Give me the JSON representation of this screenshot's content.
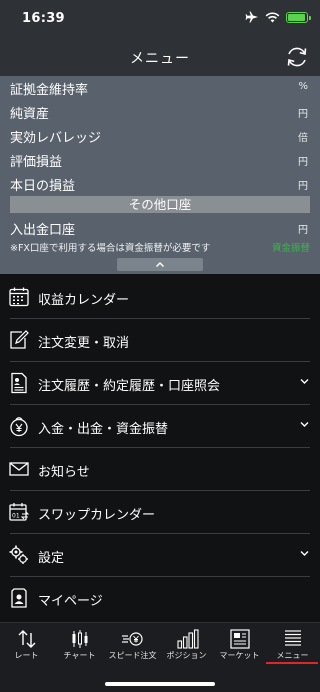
{
  "status_bar": {
    "time": "16:39",
    "battery_level": 0.85,
    "battery_color": "#5ed04f"
  },
  "header": {
    "title": "メニュー",
    "refresh_icon": "refresh-icon"
  },
  "account": {
    "rows": [
      {
        "label": "証拠金維持率",
        "unit": "%"
      },
      {
        "label": "純資産",
        "unit": "円"
      },
      {
        "label": "実効レバレッジ",
        "unit": "倍"
      },
      {
        "label": "評価損益",
        "unit": "円"
      },
      {
        "label": "本日の損益",
        "unit": "円"
      }
    ],
    "section_title": "その他口座",
    "deposit_row": {
      "label": "入出金口座",
      "unit": "円"
    },
    "note": "※FX口座で利用する場合は資金振替が必要です",
    "note_link": "資金振替",
    "collapse_icon": "chevron-up-icon"
  },
  "menu": {
    "items": [
      {
        "label": "収益カレンダー",
        "icon": "calendar-icon",
        "expandable": false
      },
      {
        "label": "注文変更・取消",
        "icon": "edit-icon",
        "expandable": false
      },
      {
        "label": "注文履歴・約定履歴・口座照会",
        "icon": "document-icon",
        "expandable": true
      },
      {
        "label": "入金・出金・資金振替",
        "icon": "yen-coin-icon",
        "expandable": true
      },
      {
        "label": "お知らせ",
        "icon": "mail-icon",
        "expandable": false
      },
      {
        "label": "スワップカレンダー",
        "icon": "swap-calendar-icon",
        "expandable": false
      },
      {
        "label": "設定",
        "icon": "gear-icon",
        "expandable": true
      },
      {
        "label": "マイページ",
        "icon": "mypage-icon",
        "expandable": false
      }
    ]
  },
  "tabbar": {
    "tabs": [
      {
        "label": "レート",
        "icon": "rate-arrows-icon"
      },
      {
        "label": "チャート",
        "icon": "candlestick-icon"
      },
      {
        "label": "スピード注文",
        "icon": "speed-order-icon"
      },
      {
        "label": "ポジション",
        "icon": "position-bars-icon"
      },
      {
        "label": "マーケット",
        "icon": "newspaper-icon"
      },
      {
        "label": "メニュー",
        "icon": "menu-list-icon"
      }
    ],
    "active": "メニュー",
    "active_color": "#e0262b"
  }
}
